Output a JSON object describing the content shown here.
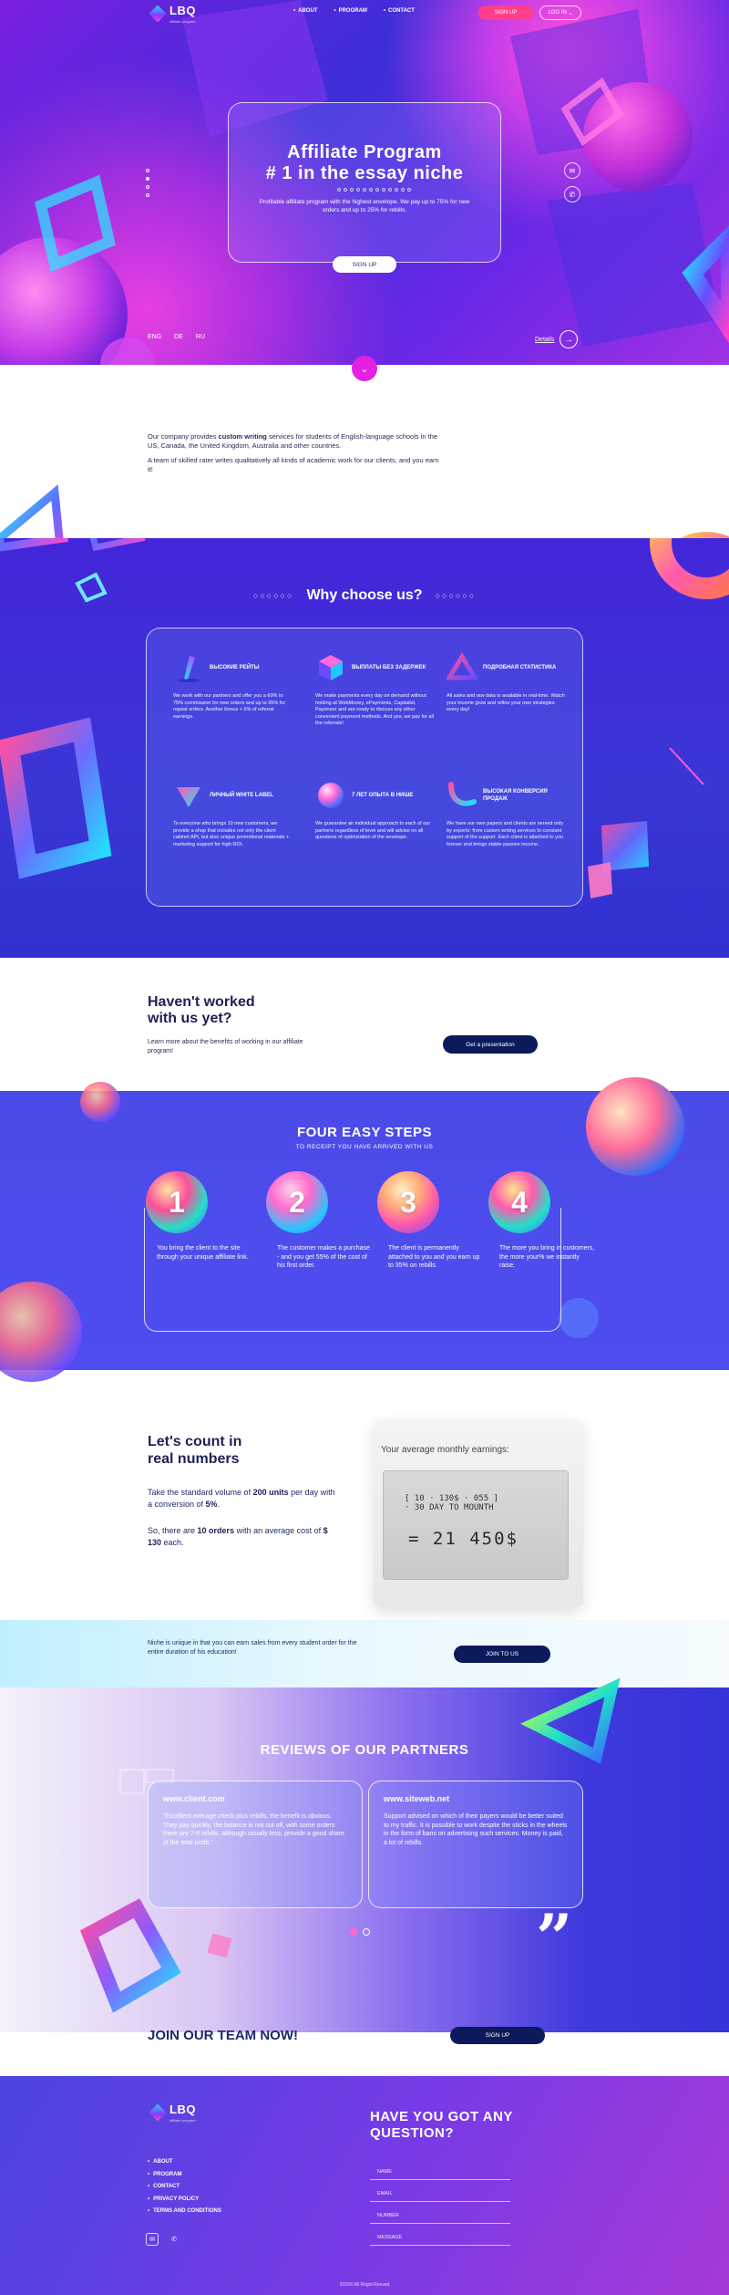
{
  "brand": {
    "name": "LBQ",
    "tagline": "affiliate program"
  },
  "nav": {
    "items": [
      "ABOUT",
      "PROGRAM",
      "CONTACT"
    ],
    "signup": "SIGN UP",
    "login": "LOG IN"
  },
  "hero": {
    "title_line1": "Affiliate Program",
    "title_line2": "# 1 in the essay niche",
    "subtitle": "Profitable affiliate program with the highest envelope. We pay up to 75% for new orders and up to 25% for rebills.",
    "cta": "SIGN UP",
    "languages": [
      "ENG",
      "DE",
      "RU"
    ],
    "details": "Details"
  },
  "intro": {
    "p1_before": "Our company provides ",
    "p1_bold": "custom writing",
    "p1_after": " services for students of English-language schools in the US, Canada, the United Kingdom, Australia and other countries.",
    "p2": "A team of skilled rater writes qualitatively all kinds of academic work for our clients, and you earn it!"
  },
  "why": {
    "title": "Why choose us?",
    "features": [
      {
        "title": "ВЫСОКИЕ РЕЙТЫ",
        "text": "We work with our partners and offer you a 60% to 75% commission for new orders and up to 35% for repeat orders. Another bonus + 5% of referral earnings."
      },
      {
        "title": "ВЫПЛАТЫ БЕЗ ЗАДЕРЖЕК",
        "text": "We make payments every day on demand without holding at WebMoney, ePayments, Capitalist, Payoneer and are ready to discuss any other convenient payment methods. And yes, we pay for all the referrals!"
      },
      {
        "title": "ПОДРОБНАЯ СТАТИСТИКА",
        "text": "All sales and raw data is available in real-time. Watch your income grow and refine your own strategies every day!"
      },
      {
        "title": "ЛИЧНЫЙ WHITE LABEL",
        "text": "To everyone who brings 10 new customers, we provide a shop that includes not only the client cabinet API, but also unique promotional materials + marketing support for high ROI."
      },
      {
        "title": "7 ЛЕТ ОПЫТА В НИШЕ",
        "text": "We guarantee an individual approach to each of our partners regardless of level and will advise on all questions of optimization of the envelope."
      },
      {
        "title": "ВЫСОКАЯ КОНВЕРСИЯ ПРОДАЖ",
        "text": "We have our own papers and clients are served only by experts: from custom writing services to constant support of the support. Each client is attached to you forever and brings stable passive income."
      }
    ]
  },
  "haveNot": {
    "title_line1": "Haven't worked",
    "title_line2": "with us yet?",
    "text": "Learn more about the benefits of working in our affiliate program!",
    "cta": "Get a presentation"
  },
  "steps": {
    "title": "FOUR EASY STEPS",
    "subtitle": "TO RECEIPT YOU HAVE ARRIVED WITH US",
    "items": [
      {
        "num": "1",
        "text": "You bring the client to the site through your unique affiliate link."
      },
      {
        "num": "2",
        "text": "The customer makes a purchase - and you get 55% of the cost of his first order."
      },
      {
        "num": "3",
        "text": "The client is permanently attached to you and you earn up to 35% on rebills."
      },
      {
        "num": "4",
        "text": "The more you bring in customers, the more your% we instantly raise."
      }
    ]
  },
  "count": {
    "title_line1": "Let's count in",
    "title_line2": "real numbers",
    "p1_a": "Take the standard volume of ",
    "p1_b": "200 units",
    "p1_c": " per day with a conversion of ",
    "p1_d": "5%",
    "p1_e": ".",
    "p2_a": "So, there are ",
    "p2_b": "10 orders",
    "p2_c": " with an average cost of ",
    "p2_d": "$ 130",
    "p2_e": " each.",
    "calc_label": "Your average monthly earnings:",
    "calc_line1": "[ 10 · 130$ · 055 ]",
    "calc_line2": "· 30 DAY TO MOUNTH",
    "calc_result": "= 21 450$"
  },
  "niche": {
    "text": "Niche is unique in that you can earn sales from every student order for the entire duration of his education!",
    "cta": "JOIN TO US"
  },
  "reviews": {
    "title": "REVIEWS OF OUR PARTNERS",
    "items": [
      {
        "site": "www.client.com",
        "text": "\"Excellent average check plus rebills, the benefit is obvious. They pay quickly, the balance is not cut off, with some orders there are 7-8 rebills, although usually less, provide a good share of the total profit.\""
      },
      {
        "site": "www.siteweb.net",
        "text": "Support advised on which of their payers would be better suited to my traffic. It is possible to work despite the sticks in the wheels in the form of bans on advertising such services. Money is paid, a lot of rebills."
      }
    ]
  },
  "join": {
    "title": "JOIN OUR TEAM NOW!",
    "cta": "SIGN UP"
  },
  "footer": {
    "links": [
      "ABOUT",
      "PROGRAM",
      "CONTACT",
      "PRIVACY POLICY",
      "TERMS AND CONDITIONS"
    ],
    "question_line1": "HAVE YOU GOT ANY",
    "question_line2": "QUESTION?",
    "fields": [
      "NAME",
      "EMAIL",
      "NUMBER",
      "MESSAGE"
    ],
    "copyright": "2020© All Rright Reeved"
  },
  "colors": {
    "navy": "#0c1a5c",
    "magenta": "#e620e0",
    "signup_pink": "#ff3f8a"
  }
}
